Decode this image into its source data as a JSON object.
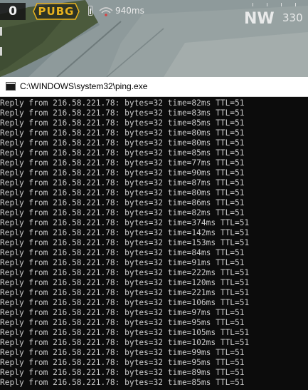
{
  "game_hud": {
    "counter": "0",
    "logo_text": "PUBG",
    "ping": "940ms",
    "compass_direction": "NW",
    "compass_degrees": "330",
    "colors": {
      "logo": "#e8b21e",
      "hud_text": "#f2f2f2"
    },
    "icons": [
      "battery-icon",
      "wifi-icon"
    ]
  },
  "window": {
    "title": "C:\\WINDOWS\\system32\\ping.exe",
    "icon": "cmd-icon",
    "background": "#0c0c0c",
    "text_color": "#cccccc"
  },
  "console": {
    "lines": [
      "Reply from 216.58.221.78: bytes=32 time=82ms TTL=51",
      "Reply from 216.58.221.78: bytes=32 time=83ms TTL=51",
      "Reply from 216.58.221.78: bytes=32 time=85ms TTL=51",
      "Reply from 216.58.221.78: bytes=32 time=80ms TTL=51",
      "Reply from 216.58.221.78: bytes=32 time=80ms TTL=51",
      "Reply from 216.58.221.78: bytes=32 time=85ms TTL=51",
      "Reply from 216.58.221.78: bytes=32 time=77ms TTL=51",
      "Reply from 216.58.221.78: bytes=32 time=90ms TTL=51",
      "Reply from 216.58.221.78: bytes=32 time=87ms TTL=51",
      "Reply from 216.58.221.78: bytes=32 time=80ms TTL=51",
      "Reply from 216.58.221.78: bytes=32 time=86ms TTL=51",
      "Reply from 216.58.221.78: bytes=32 time=82ms TTL=51",
      "Reply from 216.58.221.78: bytes=32 time=374ms TTL=51",
      "Reply from 216.58.221.78: bytes=32 time=142ms TTL=51",
      "Reply from 216.58.221.78: bytes=32 time=153ms TTL=51",
      "Reply from 216.58.221.78: bytes=32 time=84ms TTL=51",
      "Reply from 216.58.221.78: bytes=32 time=91ms TTL=51",
      "Reply from 216.58.221.78: bytes=32 time=222ms TTL=51",
      "Reply from 216.58.221.78: bytes=32 time=120ms TTL=51",
      "Reply from 216.58.221.78: bytes=32 time=221ms TTL=51",
      "Reply from 216.58.221.78: bytes=32 time=106ms TTL=51",
      "Reply from 216.58.221.78: bytes=32 time=97ms TTL=51",
      "Reply from 216.58.221.78: bytes=32 time=95ms TTL=51",
      "Reply from 216.58.221.78: bytes=32 time=105ms TTL=51",
      "Reply from 216.58.221.78: bytes=32 time=102ms TTL=51",
      "Reply from 216.58.221.78: bytes=32 time=99ms TTL=51",
      "Reply from 216.58.221.78: bytes=32 time=95ms TTL=51",
      "Reply from 216.58.221.78: bytes=32 time=89ms TTL=51",
      "Reply from 216.58.221.78: bytes=32 time=85ms TTL=51"
    ]
  }
}
